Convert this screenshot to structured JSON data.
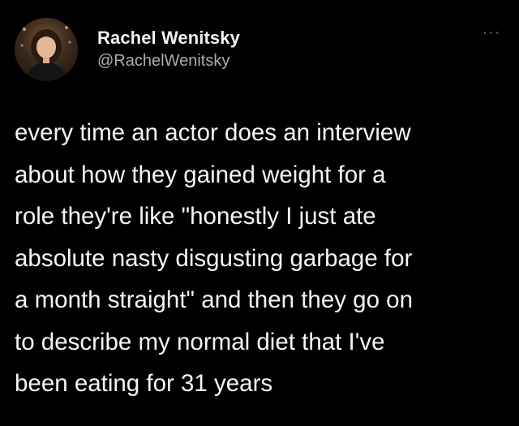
{
  "tweet": {
    "author": {
      "name": "Rachel Wenitsky",
      "handle": "@RachelWenitsky",
      "avatar_icon": "profile-photo"
    },
    "more_icon": "more-dots-icon",
    "more_glyph": "···",
    "text": "every time an actor does an interview\nabout how they gained weight for a\nrole they're like \"honestly I just ate\nabsolute nasty disgusting garbage for\na month straight\" and then they go on\nto describe my normal diet that I've\nbeen eating for 31 years"
  },
  "colors": {
    "background": "#000000",
    "name": "#f2f2f2",
    "handle": "#a9adb2",
    "text": "#f5f5f5"
  }
}
